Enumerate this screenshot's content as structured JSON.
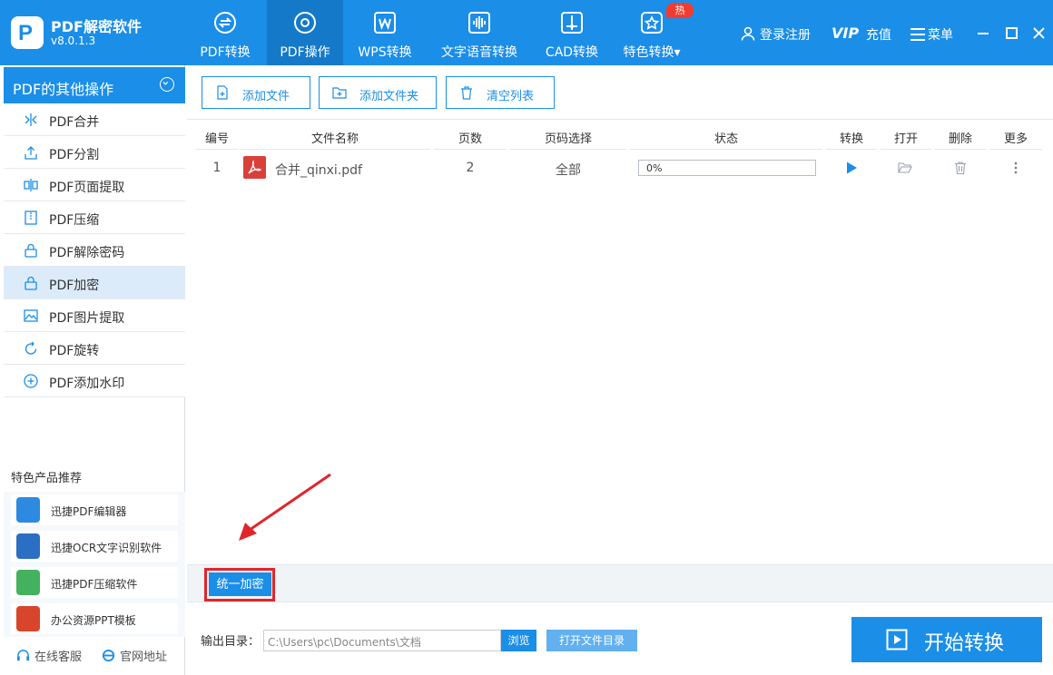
{
  "app": {
    "title": "PDF解密软件",
    "version": "v8.0.1.3"
  },
  "nav": {
    "tabs": [
      {
        "label": "PDF转换",
        "icon": "convert-icon"
      },
      {
        "label": "PDF操作",
        "icon": "gear-icon",
        "active": true
      },
      {
        "label": "WPS转换",
        "icon": "wps-icon"
      },
      {
        "label": "文字语音转换",
        "icon": "voice-icon"
      },
      {
        "label": "CAD转换",
        "icon": "cad-icon"
      },
      {
        "label": "特色转换▾",
        "icon": "star-icon",
        "badge": "热"
      }
    ],
    "login": "登录注册",
    "vip": "VIP",
    "recharge": "充值",
    "menu": "菜单"
  },
  "sidebar": {
    "header": "PDF的其他操作",
    "items": [
      {
        "label": "PDF合并",
        "icon": "merge-icon"
      },
      {
        "label": "PDF分割",
        "icon": "split-icon"
      },
      {
        "label": "PDF页面提取",
        "icon": "page-extract-icon"
      },
      {
        "label": "PDF压缩",
        "icon": "compress-icon"
      },
      {
        "label": "PDF解除密码",
        "icon": "unlock-icon"
      },
      {
        "label": "PDF加密",
        "icon": "lock-icon",
        "selected": true
      },
      {
        "label": "PDF图片提取",
        "icon": "image-extract-icon"
      },
      {
        "label": "PDF旋转",
        "icon": "rotate-icon"
      },
      {
        "label": "PDF添加水印",
        "icon": "watermark-icon"
      }
    ],
    "recommend_title": "特色产品推荐",
    "recommend": [
      {
        "label": "迅捷PDF编辑器",
        "icon": "pdf-editor-icon"
      },
      {
        "label": "迅捷OCR文字识别软件",
        "icon": "ocr-icon"
      },
      {
        "label": "迅捷PDF压缩软件",
        "icon": "pdf-compress-app-icon"
      },
      {
        "label": "办公资源PPT模板",
        "icon": "ppt-icon"
      }
    ],
    "online_service": "在线客服",
    "website": "官网地址"
  },
  "toolbar": {
    "add_file": "添加文件",
    "add_folder": "添加文件夹",
    "clear_list": "清空列表"
  },
  "table": {
    "headers": [
      "编号",
      "文件名称",
      "页数",
      "页码选择",
      "状态",
      "转换",
      "打开",
      "删除",
      "更多"
    ],
    "rows": [
      {
        "index": "1",
        "filename": "合并_qinxi.pdf",
        "pages": "2",
        "page_select": "全部",
        "progress": 0,
        "progress_text": "0%"
      }
    ]
  },
  "actions": {
    "encrypt_all": "统一加密"
  },
  "output": {
    "label": "输出目录：",
    "path": "C:\\Users\\pc\\Documents\\文档",
    "browse": "浏览",
    "open_dir": "打开文件目录"
  },
  "start_button": "开始转换",
  "colors": {
    "primary": "#1b8ee8",
    "highlight": "#e0262b",
    "hot": "#f23c2f"
  }
}
